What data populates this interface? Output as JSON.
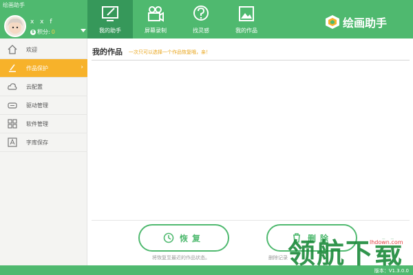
{
  "window": {
    "title": "绘画助手"
  },
  "user": {
    "name": "x x f",
    "points_label": "积分:",
    "points_value": "0"
  },
  "nav": {
    "tabs": [
      {
        "label": "我的助手",
        "icon": "monitor-brush-icon",
        "active": true
      },
      {
        "label": "屏幕录制",
        "icon": "video-camera-icon",
        "active": false
      },
      {
        "label": "找灵感",
        "icon": "lightbulb-question-icon",
        "active": false
      },
      {
        "label": "我的作品",
        "icon": "picture-frame-icon",
        "active": false
      }
    ]
  },
  "brand": {
    "name": "绘画助手"
  },
  "sidebar": {
    "items": [
      {
        "label": "欢迎",
        "icon": "home-icon"
      },
      {
        "label": "作品保护",
        "icon": "brush-protect-icon",
        "active": true
      },
      {
        "label": "云配置",
        "icon": "cloud-icon"
      },
      {
        "label": "驱动管理",
        "icon": "tablet-icon"
      },
      {
        "label": "软件管理",
        "icon": "grid-icon"
      },
      {
        "label": "字库保存",
        "icon": "font-library-icon"
      }
    ]
  },
  "main": {
    "title": "我的作品",
    "hint": "一次只可以选择一个作品恢复哦，亲！",
    "restore_label": "恢复",
    "restore_desc": "将恢复至最近的作品状态。",
    "delete_label": "删除",
    "delete_desc": "删除记录"
  },
  "footer": {
    "version": "版本：V1.3.0.0"
  },
  "watermark": {
    "text": "领航下载",
    "site": "lhdown.com"
  },
  "colors": {
    "primary": "#4fb96f",
    "active_nav": "#36985a",
    "active_side": "#f7b22a"
  }
}
